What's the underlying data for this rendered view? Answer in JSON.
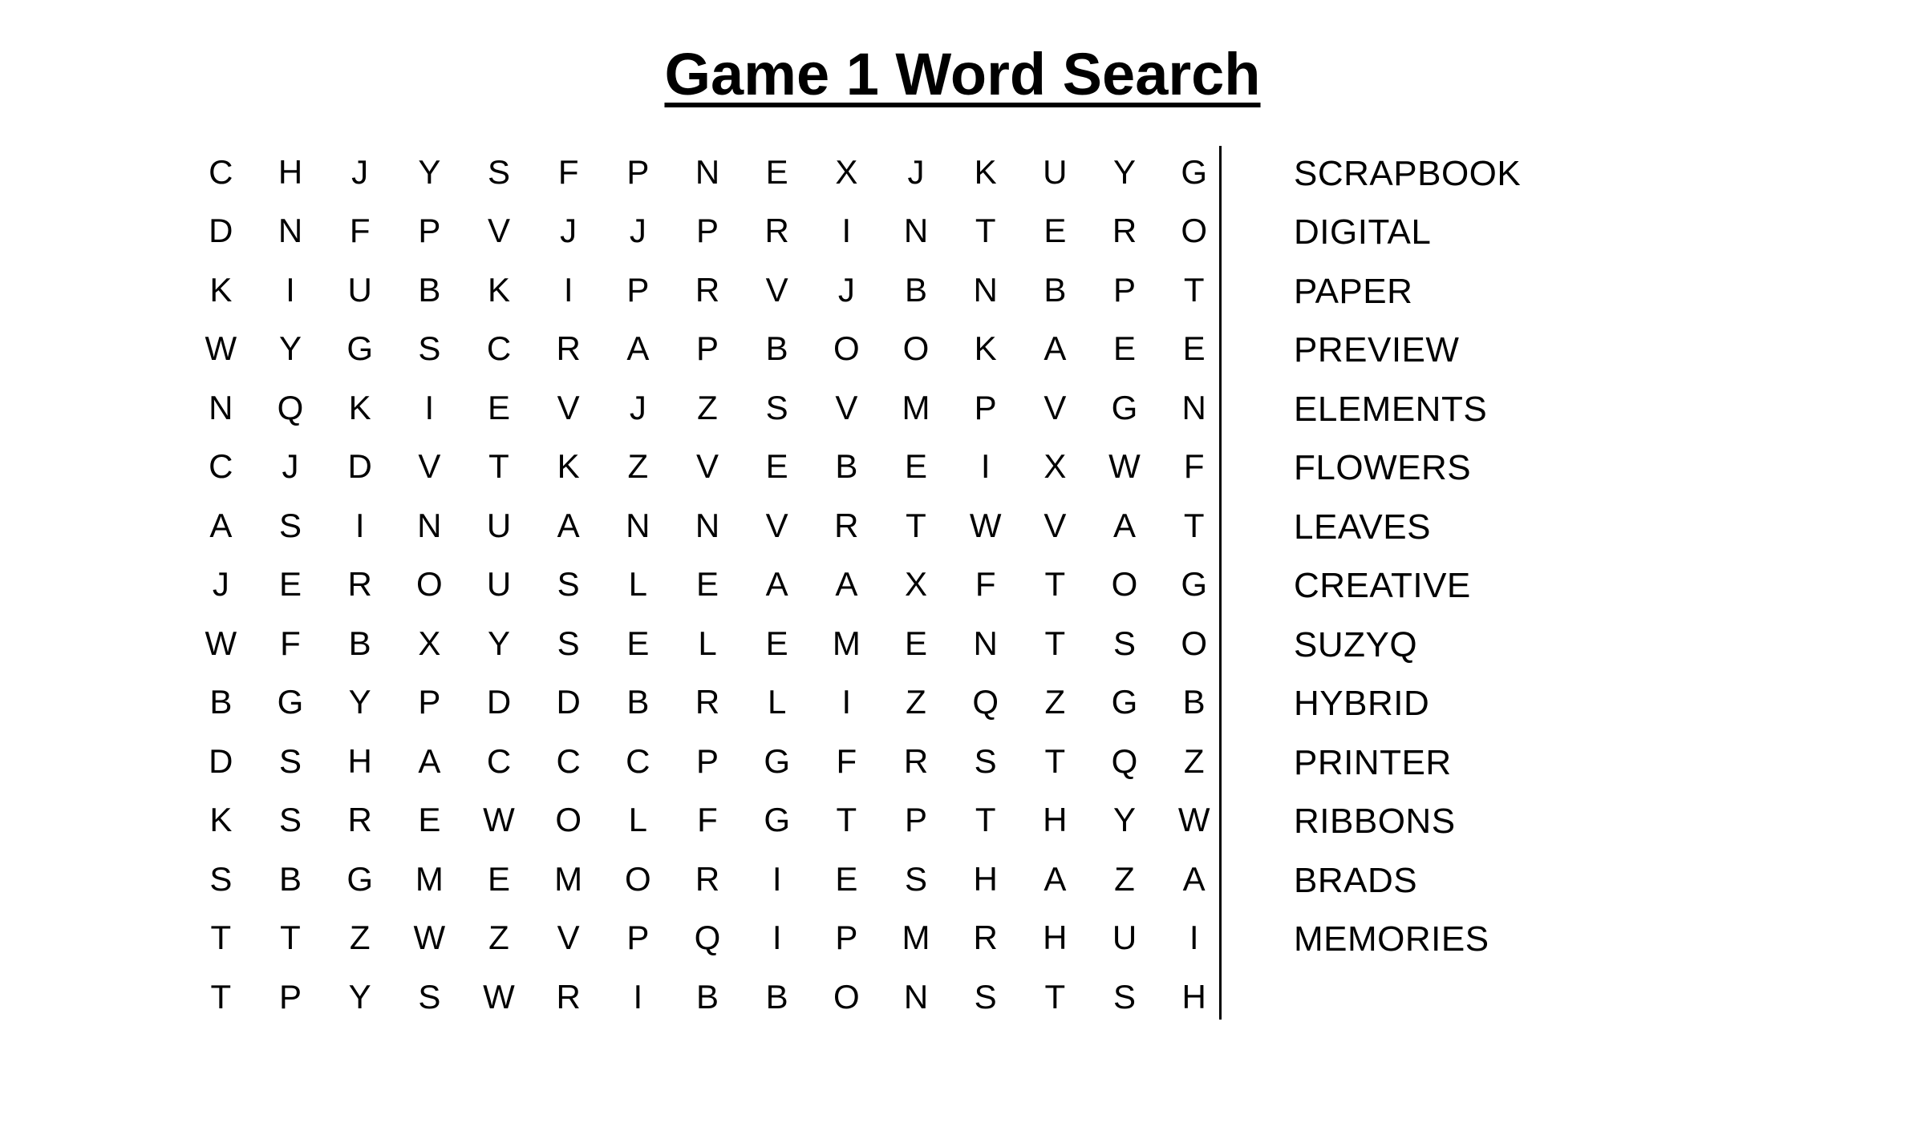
{
  "title": "Game 1 Word Search",
  "colors": {
    "text": "#000000",
    "background": "#ffffff",
    "divider": "#000000"
  },
  "grid": {
    "rows": 15,
    "columns": 15,
    "letters": [
      [
        "C",
        "H",
        "J",
        "Y",
        "S",
        "F",
        "P",
        "N",
        "E",
        "X",
        "J",
        "K",
        "U",
        "Y",
        "G"
      ],
      [
        "D",
        "N",
        "F",
        "P",
        "V",
        "J",
        "J",
        "P",
        "R",
        "I",
        "N",
        "T",
        "E",
        "R",
        "O"
      ],
      [
        "K",
        "I",
        "U",
        "B",
        "K",
        "I",
        "P",
        "R",
        "V",
        "J",
        "B",
        "N",
        "B",
        "P",
        "T"
      ],
      [
        "W",
        "Y",
        "G",
        "S",
        "C",
        "R",
        "A",
        "P",
        "B",
        "O",
        "O",
        "K",
        "A",
        "E",
        "E"
      ],
      [
        "N",
        "Q",
        "K",
        "I",
        "E",
        "V",
        "J",
        "Z",
        "S",
        "V",
        "M",
        "P",
        "V",
        "G",
        "N"
      ],
      [
        "C",
        "J",
        "D",
        "V",
        "T",
        "K",
        "Z",
        "V",
        "E",
        "B",
        "E",
        "I",
        "X",
        "W",
        "F"
      ],
      [
        "A",
        "S",
        "I",
        "N",
        "U",
        "A",
        "N",
        "N",
        "V",
        "R",
        "T",
        "W",
        "V",
        "A",
        "T"
      ],
      [
        "J",
        "E",
        "R",
        "O",
        "U",
        "S",
        "L",
        "E",
        "A",
        "A",
        "X",
        "F",
        "T",
        "O",
        "G"
      ],
      [
        "W",
        "F",
        "B",
        "X",
        "Y",
        "S",
        "E",
        "L",
        "E",
        "M",
        "E",
        "N",
        "T",
        "S",
        "O"
      ],
      [
        "B",
        "G",
        "Y",
        "P",
        "D",
        "D",
        "B",
        "R",
        "L",
        "I",
        "Z",
        "Q",
        "Z",
        "G",
        "B"
      ],
      [
        "D",
        "S",
        "H",
        "A",
        "C",
        "C",
        "C",
        "P",
        "G",
        "F",
        "R",
        "S",
        "T",
        "Q",
        "Z"
      ],
      [
        "K",
        "S",
        "R",
        "E",
        "W",
        "O",
        "L",
        "F",
        "G",
        "T",
        "P",
        "T",
        "H",
        "Y",
        "W"
      ],
      [
        "S",
        "B",
        "G",
        "M",
        "E",
        "M",
        "O",
        "R",
        "I",
        "E",
        "S",
        "H",
        "A",
        "Z",
        "A"
      ],
      [
        "T",
        "T",
        "Z",
        "W",
        "Z",
        "V",
        "P",
        "Q",
        "I",
        "P",
        "M",
        "R",
        "H",
        "U",
        "I"
      ],
      [
        "T",
        "P",
        "Y",
        "S",
        "W",
        "R",
        "I",
        "B",
        "B",
        "O",
        "N",
        "S",
        "T",
        "S",
        "H"
      ]
    ]
  },
  "word_list": {
    "words": [
      "SCRAPBOOK",
      "DIGITAL",
      "PAPER",
      "PREVIEW",
      "ELEMENTS",
      "FLOWERS",
      "LEAVES",
      "CREATIVE",
      "SUZYQ",
      "HYBRID",
      "PRINTER",
      "RIBBONS",
      "BRADS",
      "MEMORIES"
    ]
  }
}
